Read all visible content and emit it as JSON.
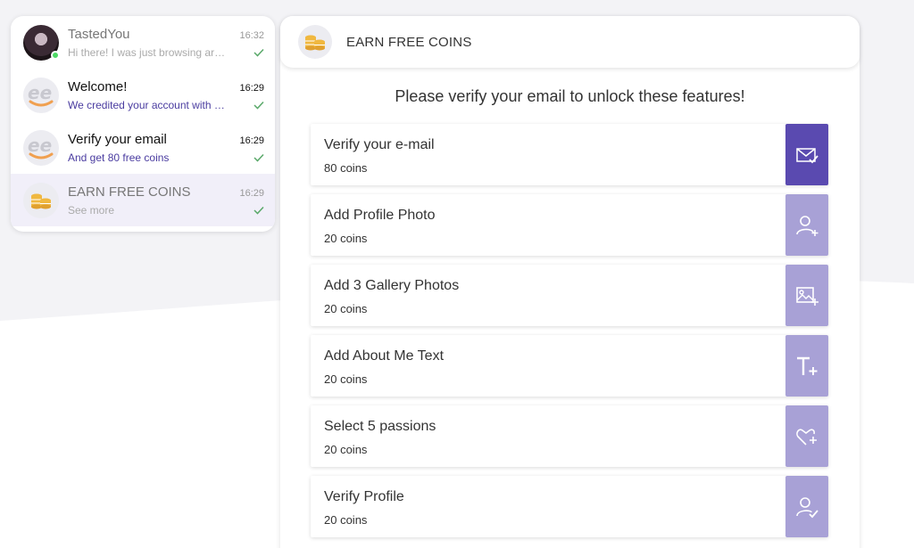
{
  "conversations": [
    {
      "name": "TastedYou",
      "time": "16:32",
      "preview": "Hi there! I was just browsing aro...",
      "avatar": "photo-avatar",
      "online": true,
      "bold": false
    },
    {
      "name": "Welcome!",
      "time": "16:29",
      "preview": "We credited your account with 6...",
      "avatar": "ee-logo-icon",
      "bold": true
    },
    {
      "name": "Verify your email",
      "time": "16:29",
      "preview": "And get 80 free coins",
      "avatar": "ee-logo-icon",
      "bold": true
    },
    {
      "name": "EARN FREE COINS",
      "time": "16:29",
      "preview": "See more",
      "avatar": "coins-icon",
      "bold": false,
      "active": true
    }
  ],
  "main": {
    "header_title": "EARN FREE COINS",
    "verify_message": "Please verify your email to unlock these features!",
    "tasks": [
      {
        "title": "Verify your e-mail",
        "coins": "80 coins",
        "icon": "mail-check-icon"
      },
      {
        "title": "Add Profile Photo",
        "coins": "20 coins",
        "icon": "user-add-icon"
      },
      {
        "title": "Add 3 Gallery Photos",
        "coins": "20 coins",
        "icon": "image-add-icon"
      },
      {
        "title": "Add About Me Text",
        "coins": "20 coins",
        "icon": "text-add-icon"
      },
      {
        "title": "Select 5 passions",
        "coins": "20 coins",
        "icon": "heart-add-icon"
      },
      {
        "title": "Verify Profile",
        "coins": "20 coins",
        "icon": "user-check-icon"
      }
    ]
  },
  "colors": {
    "accent": "#5a4ab0",
    "accent_light": "#a8a1d6",
    "check": "#5aa96a",
    "coin": "#f0b840"
  }
}
